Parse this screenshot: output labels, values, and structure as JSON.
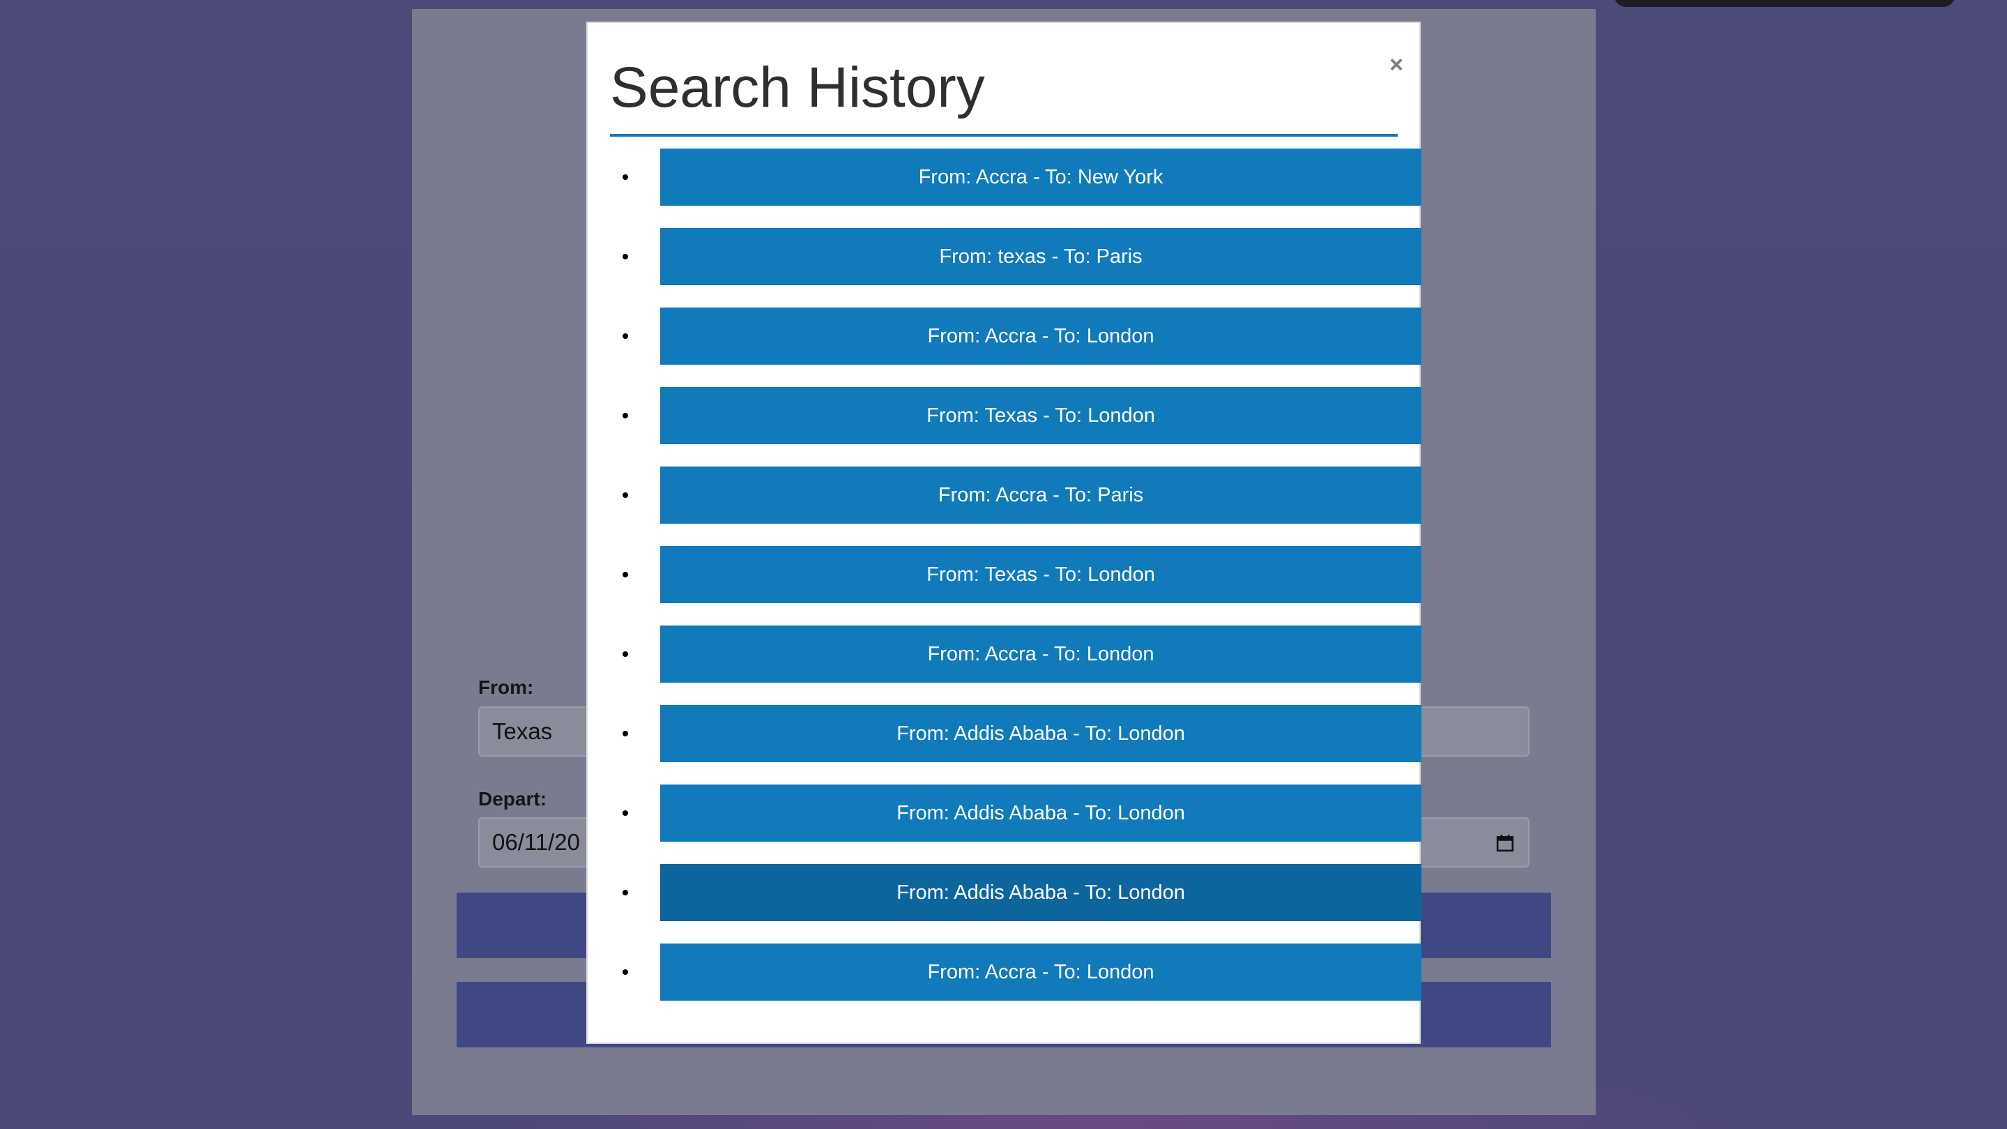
{
  "form": {
    "from_label": "From:",
    "from_value": "Texas",
    "depart_label": "Depart:",
    "depart_value": "06/11/20"
  },
  "modal": {
    "title": "Search History",
    "close_label": "×",
    "items": [
      "From: Accra - To: New York",
      "From: texas - To: Paris",
      "From: Accra - To: London",
      "From: Texas - To: London",
      "From: Accra - To: Paris",
      "From: Texas - To: London",
      "From: Accra - To: London",
      "From: Addis Ababa - To: London",
      "From: Addis Ababa - To: London",
      "From: Addis Ababa - To: London",
      "From: Accra - To: London"
    ]
  },
  "icons": {
    "calendar": "calendar-icon",
    "close": "close-icon"
  },
  "colors": {
    "accent": "#107abb",
    "accent_hover": "#0d659e",
    "rule": "#1b75b6",
    "background": "#4b4877"
  }
}
